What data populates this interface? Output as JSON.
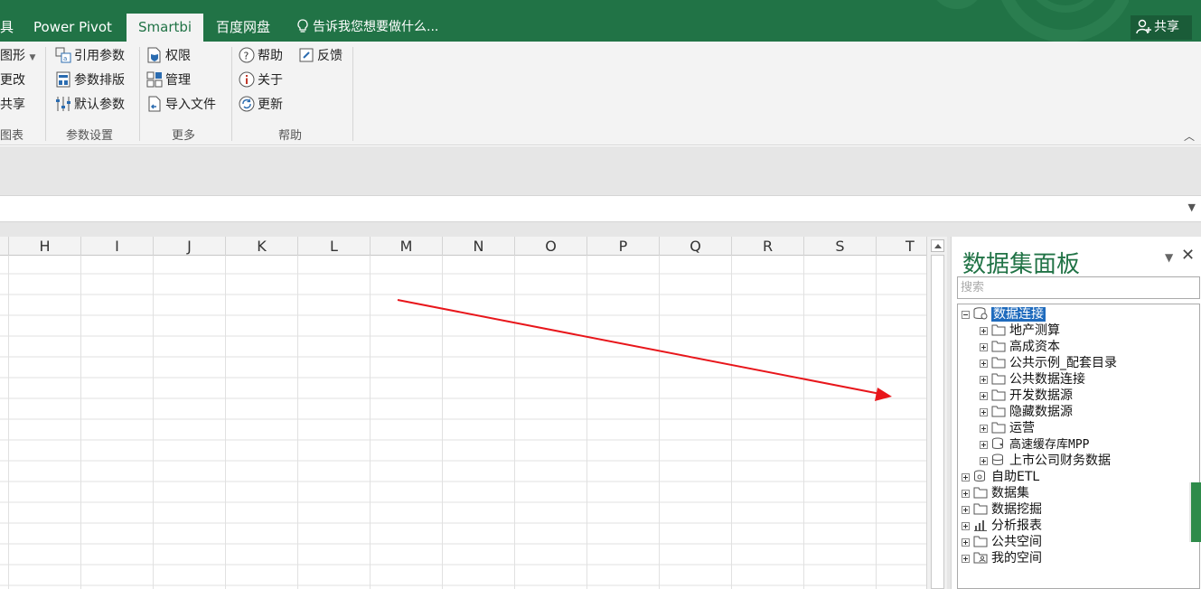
{
  "ribbon_tabs": {
    "partial_left": "具",
    "power_pivot": "Power Pivot",
    "smartbi": "Smartbi",
    "baidu": "百度网盘",
    "tellme": "告诉我您想要做什么...",
    "share": "共享"
  },
  "ribbon": {
    "partial_group": {
      "items": [
        "图形",
        "更改",
        "共享"
      ],
      "label": "图表"
    },
    "params_group": {
      "items": [
        "引用参数",
        "参数排版",
        "默认参数"
      ],
      "label": "参数设置"
    },
    "more_group": {
      "items": [
        "权限",
        "管理",
        "导入文件"
      ],
      "label": "更多"
    },
    "help_group": {
      "items": [
        "帮助",
        "关于",
        "更新"
      ],
      "feedback": "反馈",
      "label": "帮助"
    }
  },
  "sheet": {
    "columns": [
      "H",
      "I",
      "J",
      "K",
      "L",
      "M",
      "N",
      "O",
      "P",
      "Q",
      "R",
      "S",
      "T"
    ]
  },
  "panel": {
    "title": "数据集面板",
    "search_placeholder": "搜索",
    "tree": {
      "root": "数据连接",
      "children": [
        "地产测算",
        "高成资本",
        "公共示例_配套目录",
        "公共数据连接",
        "开发数据源",
        "隐藏数据源",
        "运营",
        "高速缓存库MPP",
        "上市公司财务数据"
      ],
      "top": [
        "自助ETL",
        "数据集",
        "数据挖掘",
        "分析报表",
        "公共空间",
        "我的空间"
      ]
    }
  },
  "colors": {
    "accent": "#217346",
    "arrow": "#e8161b",
    "selection": "#1f6bbd"
  }
}
